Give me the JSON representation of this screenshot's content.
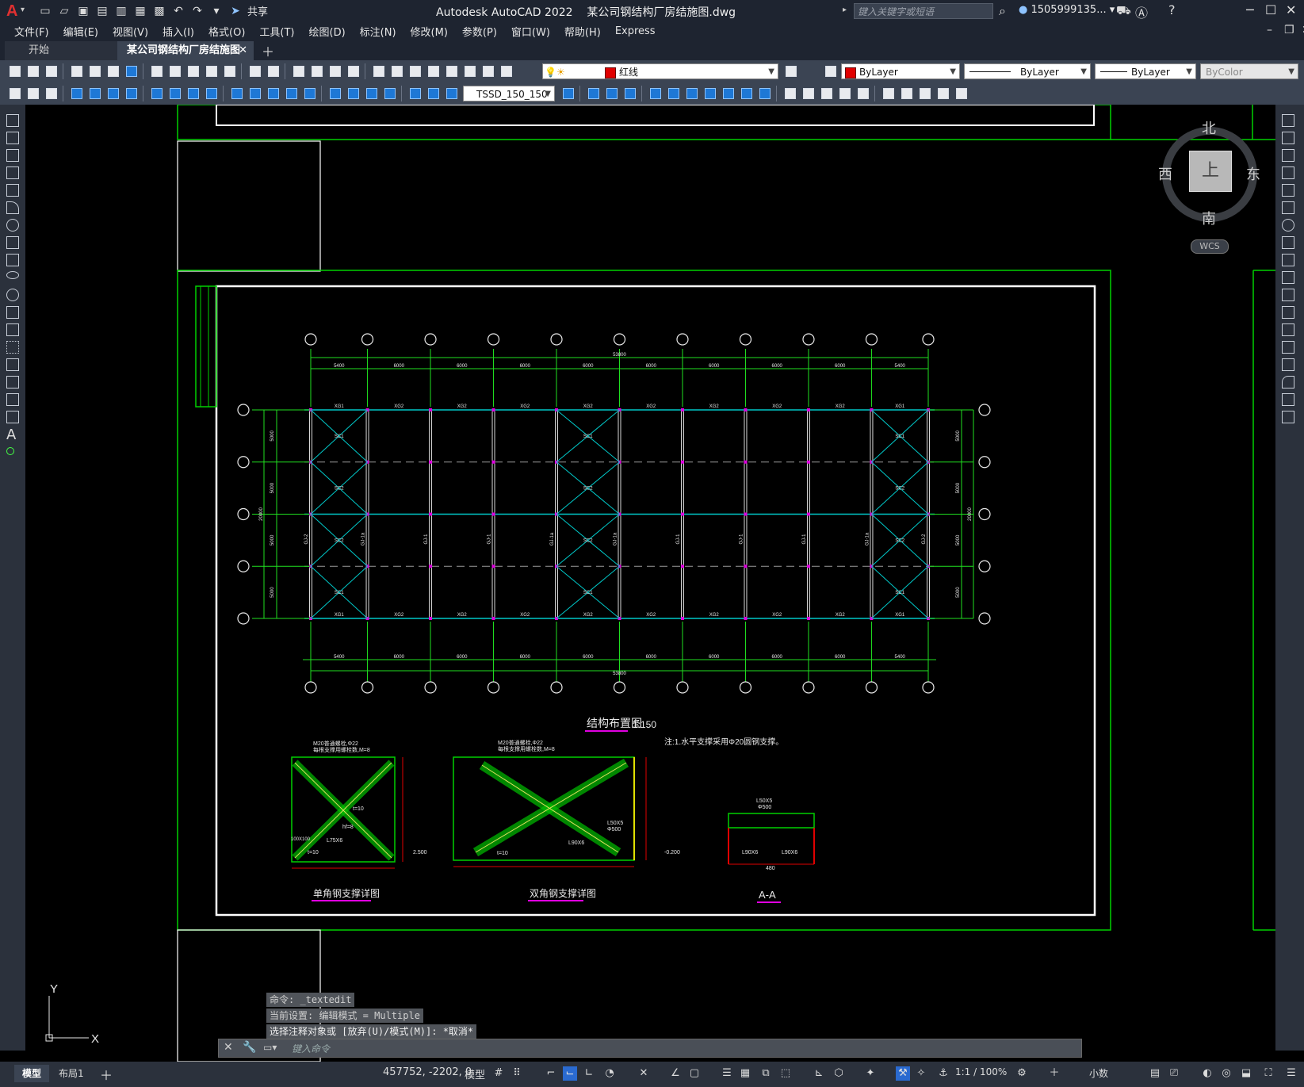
{
  "app": {
    "logo": "A",
    "title": "Autodesk AutoCAD 2022",
    "filename": "某公司钢结构厂房结施图.dwg",
    "share_label": "共享",
    "search_placeholder": "键入关键字或短语",
    "user": "1505999135..."
  },
  "menu": [
    "文件(F)",
    "编辑(E)",
    "视图(V)",
    "插入(I)",
    "格式(O)",
    "工具(T)",
    "绘图(D)",
    "标注(N)",
    "修改(M)",
    "参数(P)",
    "窗口(W)",
    "帮助(H)",
    "Express"
  ],
  "tabs": {
    "start": "开始",
    "document": "某公司钢结构厂房结施图*"
  },
  "toolbar": {
    "layer": "红线",
    "color": "ByLayer",
    "linetype": "ByLayer",
    "lineweight": "ByLayer",
    "plotstyle": "ByColor",
    "dimstyle": "TSSD_150_150"
  },
  "viewcube": {
    "north": "北",
    "south": "南",
    "east": "东",
    "west": "西",
    "top": "上",
    "wcs": "WCS"
  },
  "drawing": {
    "plan_title": "结构布置图",
    "plan_scale": "1:150",
    "note": "注:1.水平支撑采用Φ20圆钢支撑。",
    "detail1_title": "单角钢支撑详图",
    "detail2_title": "双角钢支撑详图",
    "section_title": "A-A",
    "overall_dim": "53800",
    "bay_dims": [
      "5400",
      "6000",
      "6000",
      "6000",
      "6000",
      "6000",
      "6000",
      "6000",
      "6000",
      "5400"
    ],
    "span_dims": [
      "5000",
      "5000",
      "5000",
      "5000"
    ],
    "total_span": "20000",
    "bay_labels_top": [
      "XG1",
      "XG2",
      "XG2",
      "XG2",
      "XG2",
      "XG2",
      "XG2",
      "XG2",
      "XG2",
      "XG1"
    ],
    "column_labels": [
      "GJ-2",
      "GJ-1a",
      "GJ-1",
      "GJ-1",
      "GJ-1a",
      "GJ-1a",
      "GJ-1",
      "GJ-1",
      "GJ-1",
      "GJ-1a",
      "GJ-2"
    ],
    "brace_labels": [
      "SC1",
      "SC2",
      "SC2",
      "SC1"
    ],
    "d1_notes": [
      "M20普通螺栓,Φ22",
      "每根支撑用螺栓数,M=8",
      "t=10",
      "hf=8",
      "L75X6",
      "100X100",
      "t=10",
      "2.500"
    ],
    "d2_notes": [
      "M20普通螺栓,Φ22",
      "每根支撑用螺栓数,M=8",
      "L50X5",
      "Φ500",
      "L90X6",
      "t=10",
      "-0.200"
    ],
    "aa_notes": [
      "L50X5",
      "Φ500",
      "L90X6",
      "L90X6",
      "480"
    ]
  },
  "command": {
    "history": [
      "命令: _textedit",
      "当前设置: 编辑模式 = Multiple",
      "选择注释对象或 [放弃(U)/模式(M)]: *取消*"
    ],
    "placeholder": "键入命令"
  },
  "status": {
    "tab_model": "模型",
    "tab_layout1": "布局1",
    "coords": "457752, -2202, 0",
    "space": "模型",
    "annoscale": "1:1 / 100%",
    "units": "小数"
  },
  "colors": {
    "frame_green": "#00d000",
    "grid_cyan": "#00c8c8",
    "dim_green": "#20e020",
    "column_white": "#d8d8d8",
    "accent_red": "#e00000"
  }
}
